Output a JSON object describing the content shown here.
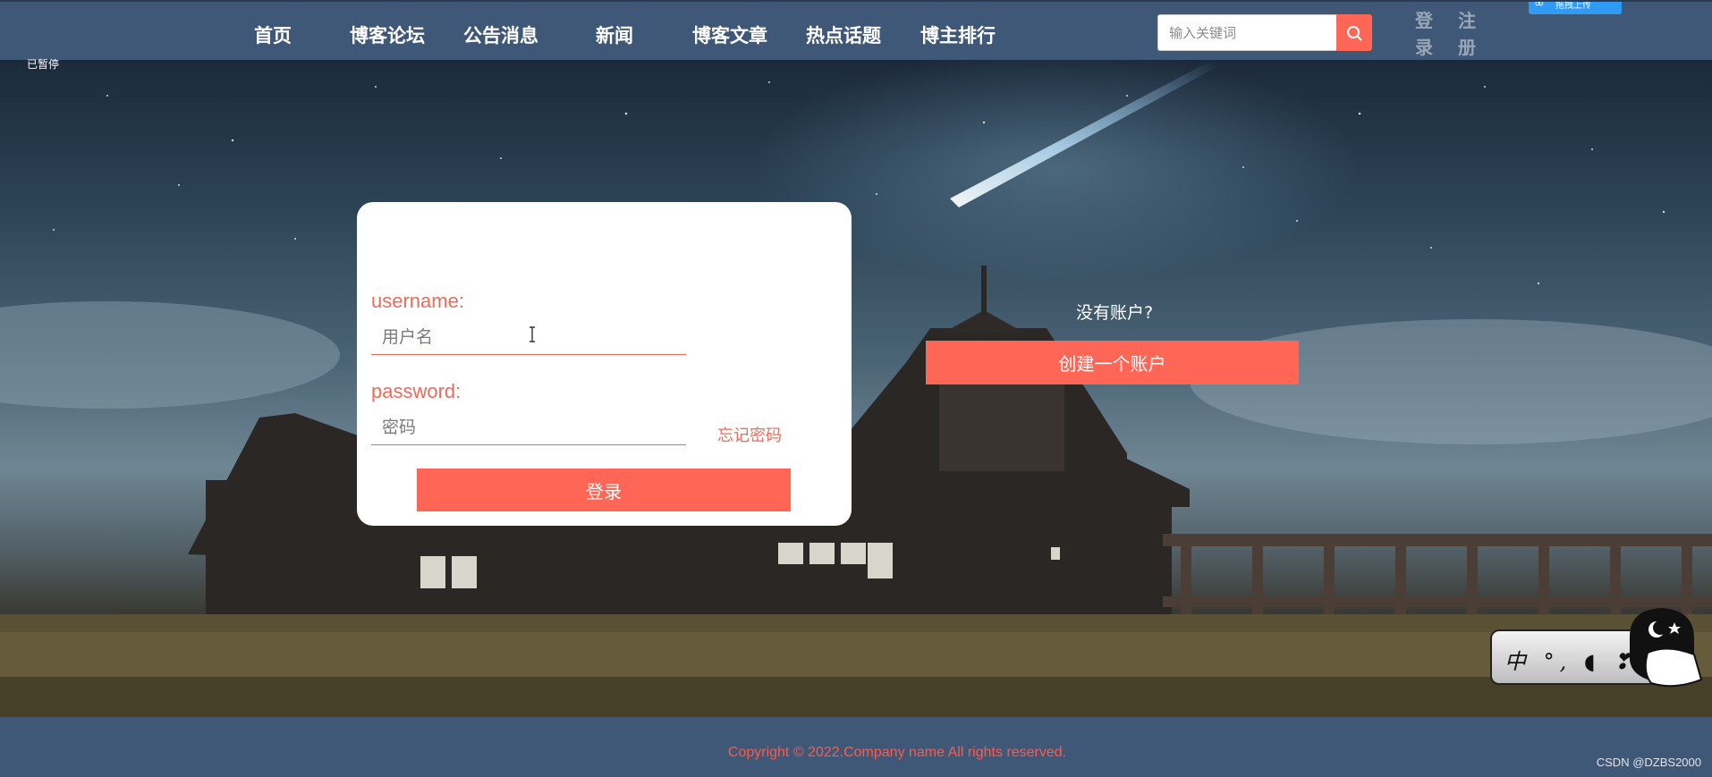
{
  "nav": {
    "items": [
      {
        "label": "首页"
      },
      {
        "label": "博客论坛"
      },
      {
        "label": "公告消息"
      },
      {
        "label": "新闻"
      },
      {
        "label": "博客文章"
      },
      {
        "label": "热点话题"
      },
      {
        "label": "博主排行"
      }
    ]
  },
  "search": {
    "placeholder": "输入关键词",
    "icon": "search-icon"
  },
  "auth": {
    "login_label": "登录",
    "register_label": "注册",
    "login_chars": [
      "登",
      "录"
    ],
    "register_chars": [
      "注",
      "册"
    ]
  },
  "upload_badge": {
    "label": "拖拽上传"
  },
  "video_status": "已暂停",
  "login_form": {
    "username_label": "username:",
    "username_placeholder": "用户名",
    "password_label": "password:",
    "password_placeholder": "密码",
    "forgot_label": "忘记密码",
    "submit_label": "登录"
  },
  "register_prompt": {
    "question": "没有账户?",
    "button_label": "创建一个账户"
  },
  "ime": {
    "text": "中 °, ◖ ❣"
  },
  "footer": {
    "copyright": "Copyright © 2022.Company name All rights reserved.",
    "watermark": "CSDN @DZBS2000"
  },
  "colors": {
    "header_bg": "#3f5877",
    "accent": "#ff6655",
    "label_text": "#ee6b5c"
  }
}
